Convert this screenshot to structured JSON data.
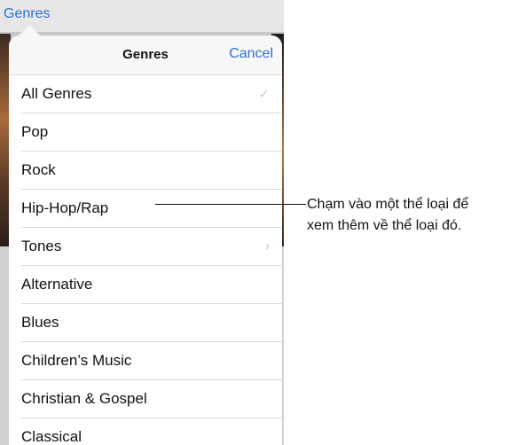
{
  "background": {
    "nav_link": "Genres"
  },
  "popover": {
    "title": "Genres",
    "cancel_label": "Cancel",
    "items": [
      {
        "label": "All Genres",
        "accessory": "✓"
      },
      {
        "label": "Pop",
        "accessory": ""
      },
      {
        "label": "Rock",
        "accessory": ""
      },
      {
        "label": "Hip-Hop/Rap",
        "accessory": ""
      },
      {
        "label": "Tones",
        "accessory": "›"
      },
      {
        "label": "Alternative",
        "accessory": ""
      },
      {
        "label": "Blues",
        "accessory": ""
      },
      {
        "label": "Children’s Music",
        "accessory": ""
      },
      {
        "label": "Christian & Gospel",
        "accessory": ""
      },
      {
        "label": "Classical",
        "accessory": ""
      }
    ]
  },
  "callout": {
    "line1": "Chạm vào một thể loại để",
    "line2": "xem thêm về thể loại đó."
  },
  "colors": {
    "accent": "#2b6fd6",
    "text": "#111111",
    "separator": "#dcdcdc"
  }
}
